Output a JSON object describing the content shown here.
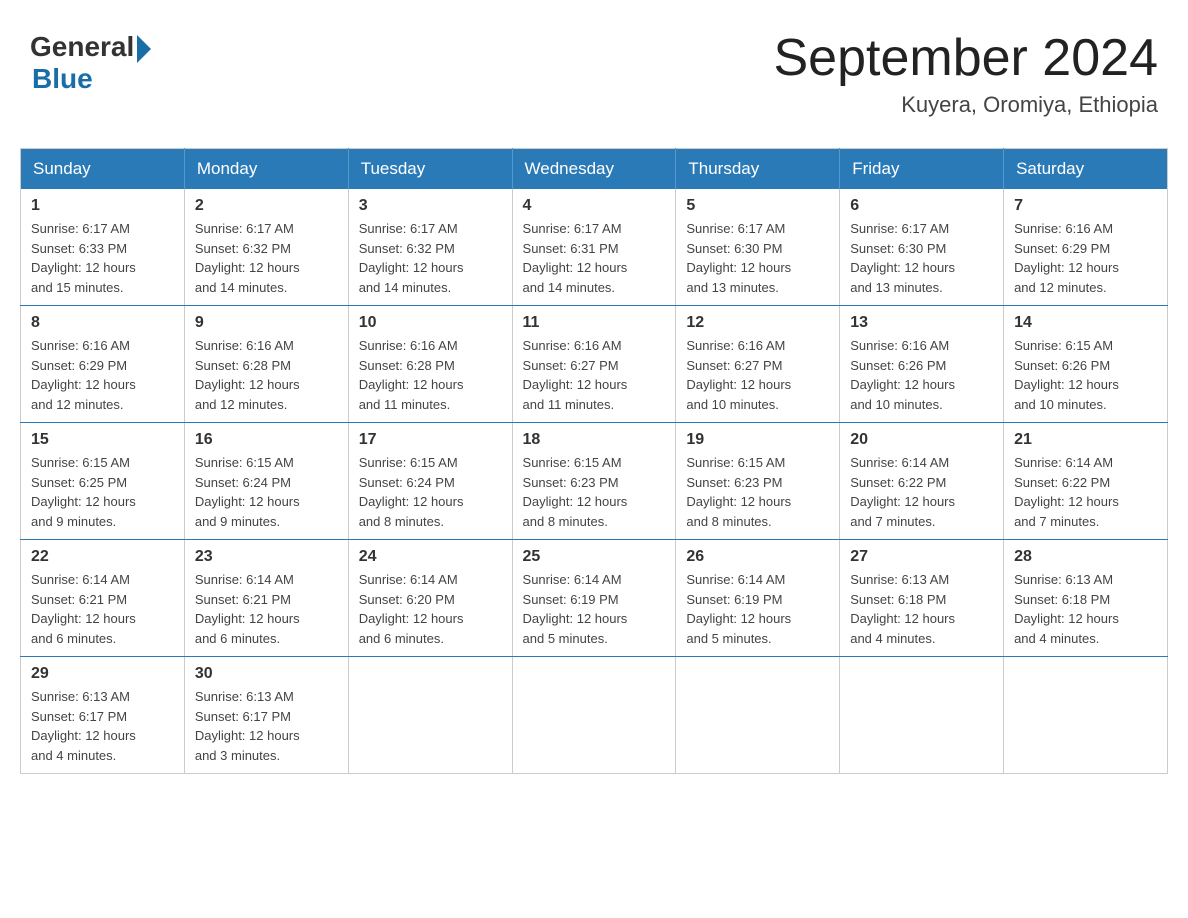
{
  "logo": {
    "general": "General",
    "blue": "Blue"
  },
  "title": "September 2024",
  "subtitle": "Kuyera, Oromiya, Ethiopia",
  "days_of_week": [
    "Sunday",
    "Monday",
    "Tuesday",
    "Wednesday",
    "Thursday",
    "Friday",
    "Saturday"
  ],
  "weeks": [
    [
      {
        "day": "1",
        "sunrise": "6:17 AM",
        "sunset": "6:33 PM",
        "daylight": "12 hours and 15 minutes."
      },
      {
        "day": "2",
        "sunrise": "6:17 AM",
        "sunset": "6:32 PM",
        "daylight": "12 hours and 14 minutes."
      },
      {
        "day": "3",
        "sunrise": "6:17 AM",
        "sunset": "6:32 PM",
        "daylight": "12 hours and 14 minutes."
      },
      {
        "day": "4",
        "sunrise": "6:17 AM",
        "sunset": "6:31 PM",
        "daylight": "12 hours and 14 minutes."
      },
      {
        "day": "5",
        "sunrise": "6:17 AM",
        "sunset": "6:30 PM",
        "daylight": "12 hours and 13 minutes."
      },
      {
        "day": "6",
        "sunrise": "6:17 AM",
        "sunset": "6:30 PM",
        "daylight": "12 hours and 13 minutes."
      },
      {
        "day": "7",
        "sunrise": "6:16 AM",
        "sunset": "6:29 PM",
        "daylight": "12 hours and 12 minutes."
      }
    ],
    [
      {
        "day": "8",
        "sunrise": "6:16 AM",
        "sunset": "6:29 PM",
        "daylight": "12 hours and 12 minutes."
      },
      {
        "day": "9",
        "sunrise": "6:16 AM",
        "sunset": "6:28 PM",
        "daylight": "12 hours and 12 minutes."
      },
      {
        "day": "10",
        "sunrise": "6:16 AM",
        "sunset": "6:28 PM",
        "daylight": "12 hours and 11 minutes."
      },
      {
        "day": "11",
        "sunrise": "6:16 AM",
        "sunset": "6:27 PM",
        "daylight": "12 hours and 11 minutes."
      },
      {
        "day": "12",
        "sunrise": "6:16 AM",
        "sunset": "6:27 PM",
        "daylight": "12 hours and 10 minutes."
      },
      {
        "day": "13",
        "sunrise": "6:16 AM",
        "sunset": "6:26 PM",
        "daylight": "12 hours and 10 minutes."
      },
      {
        "day": "14",
        "sunrise": "6:15 AM",
        "sunset": "6:26 PM",
        "daylight": "12 hours and 10 minutes."
      }
    ],
    [
      {
        "day": "15",
        "sunrise": "6:15 AM",
        "sunset": "6:25 PM",
        "daylight": "12 hours and 9 minutes."
      },
      {
        "day": "16",
        "sunrise": "6:15 AM",
        "sunset": "6:24 PM",
        "daylight": "12 hours and 9 minutes."
      },
      {
        "day": "17",
        "sunrise": "6:15 AM",
        "sunset": "6:24 PM",
        "daylight": "12 hours and 8 minutes."
      },
      {
        "day": "18",
        "sunrise": "6:15 AM",
        "sunset": "6:23 PM",
        "daylight": "12 hours and 8 minutes."
      },
      {
        "day": "19",
        "sunrise": "6:15 AM",
        "sunset": "6:23 PM",
        "daylight": "12 hours and 8 minutes."
      },
      {
        "day": "20",
        "sunrise": "6:14 AM",
        "sunset": "6:22 PM",
        "daylight": "12 hours and 7 minutes."
      },
      {
        "day": "21",
        "sunrise": "6:14 AM",
        "sunset": "6:22 PM",
        "daylight": "12 hours and 7 minutes."
      }
    ],
    [
      {
        "day": "22",
        "sunrise": "6:14 AM",
        "sunset": "6:21 PM",
        "daylight": "12 hours and 6 minutes."
      },
      {
        "day": "23",
        "sunrise": "6:14 AM",
        "sunset": "6:21 PM",
        "daylight": "12 hours and 6 minutes."
      },
      {
        "day": "24",
        "sunrise": "6:14 AM",
        "sunset": "6:20 PM",
        "daylight": "12 hours and 6 minutes."
      },
      {
        "day": "25",
        "sunrise": "6:14 AM",
        "sunset": "6:19 PM",
        "daylight": "12 hours and 5 minutes."
      },
      {
        "day": "26",
        "sunrise": "6:14 AM",
        "sunset": "6:19 PM",
        "daylight": "12 hours and 5 minutes."
      },
      {
        "day": "27",
        "sunrise": "6:13 AM",
        "sunset": "6:18 PM",
        "daylight": "12 hours and 4 minutes."
      },
      {
        "day": "28",
        "sunrise": "6:13 AM",
        "sunset": "6:18 PM",
        "daylight": "12 hours and 4 minutes."
      }
    ],
    [
      {
        "day": "29",
        "sunrise": "6:13 AM",
        "sunset": "6:17 PM",
        "daylight": "12 hours and 4 minutes."
      },
      {
        "day": "30",
        "sunrise": "6:13 AM",
        "sunset": "6:17 PM",
        "daylight": "12 hours and 3 minutes."
      },
      null,
      null,
      null,
      null,
      null
    ]
  ],
  "labels": {
    "sunrise": "Sunrise:",
    "sunset": "Sunset:",
    "daylight": "Daylight:"
  }
}
